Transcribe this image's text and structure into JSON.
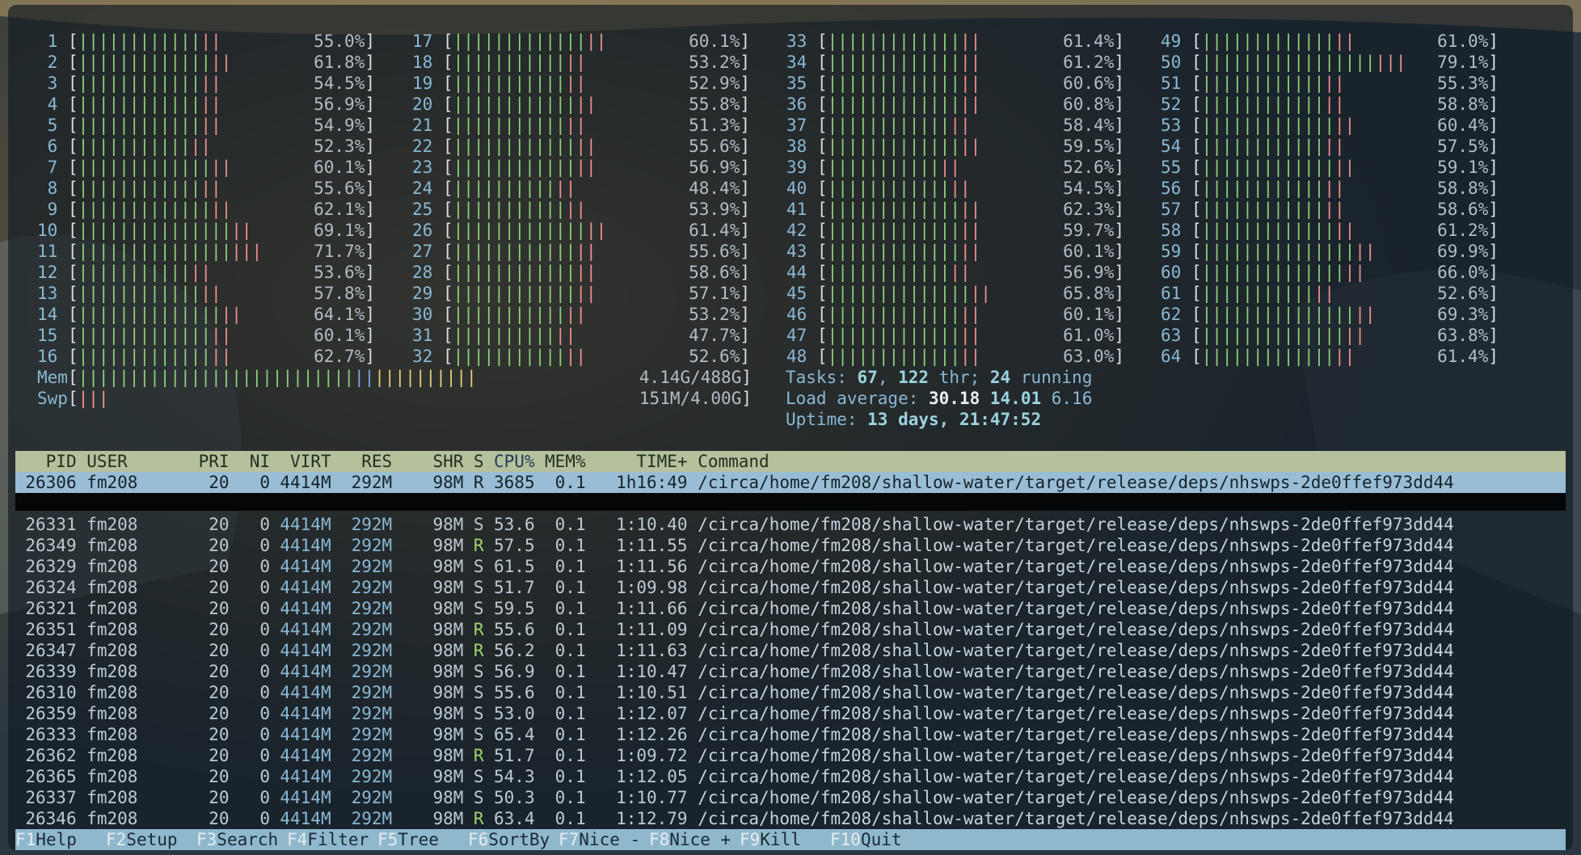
{
  "cpus": [
    {
      "id": "1",
      "pct": "55.0%",
      "g": 12,
      "r": 2,
      "y": 0,
      "b": 0
    },
    {
      "id": "2",
      "pct": "61.8%",
      "g": 13,
      "r": 2,
      "y": 0,
      "b": 0
    },
    {
      "id": "3",
      "pct": "54.5%",
      "g": 12,
      "r": 2,
      "y": 0,
      "b": 0
    },
    {
      "id": "4",
      "pct": "56.9%",
      "g": 12,
      "r": 2,
      "y": 0,
      "b": 0
    },
    {
      "id": "5",
      "pct": "54.9%",
      "g": 12,
      "r": 2,
      "y": 0,
      "b": 0
    },
    {
      "id": "6",
      "pct": "52.3%",
      "g": 11,
      "r": 2,
      "y": 0,
      "b": 0
    },
    {
      "id": "7",
      "pct": "60.1%",
      "g": 13,
      "r": 2,
      "y": 0,
      "b": 0
    },
    {
      "id": "8",
      "pct": "55.6%",
      "g": 12,
      "r": 2,
      "y": 0,
      "b": 0
    },
    {
      "id": "9",
      "pct": "62.1%",
      "g": 13,
      "r": 2,
      "y": 0,
      "b": 0
    },
    {
      "id": "10",
      "pct": "69.1%",
      "g": 15,
      "r": 2,
      "y": 0,
      "b": 0
    },
    {
      "id": "11",
      "pct": "71.7%",
      "g": 15,
      "r": 3,
      "y": 0,
      "b": 0
    },
    {
      "id": "12",
      "pct": "53.6%",
      "g": 11,
      "r": 2,
      "y": 0,
      "b": 0
    },
    {
      "id": "13",
      "pct": "57.8%",
      "g": 12,
      "r": 2,
      "y": 0,
      "b": 0
    },
    {
      "id": "14",
      "pct": "64.1%",
      "g": 14,
      "r": 2,
      "y": 0,
      "b": 0
    },
    {
      "id": "15",
      "pct": "60.1%",
      "g": 13,
      "r": 2,
      "y": 0,
      "b": 0
    },
    {
      "id": "16",
      "pct": "62.7%",
      "g": 13,
      "r": 2,
      "y": 0,
      "b": 0
    },
    {
      "id": "17",
      "pct": "60.1%",
      "g": 13,
      "r": 2,
      "y": 0,
      "b": 0
    },
    {
      "id": "18",
      "pct": "53.2%",
      "g": 11,
      "r": 2,
      "y": 0,
      "b": 0
    },
    {
      "id": "19",
      "pct": "52.9%",
      "g": 11,
      "r": 2,
      "y": 0,
      "b": 0
    },
    {
      "id": "20",
      "pct": "55.8%",
      "g": 12,
      "r": 2,
      "y": 0,
      "b": 0
    },
    {
      "id": "21",
      "pct": "51.3%",
      "g": 11,
      "r": 2,
      "y": 0,
      "b": 0
    },
    {
      "id": "22",
      "pct": "55.6%",
      "g": 12,
      "r": 2,
      "y": 0,
      "b": 0
    },
    {
      "id": "23",
      "pct": "56.9%",
      "g": 12,
      "r": 2,
      "y": 0,
      "b": 0
    },
    {
      "id": "24",
      "pct": "48.4%",
      "g": 10,
      "r": 2,
      "y": 0,
      "b": 0
    },
    {
      "id": "25",
      "pct": "53.9%",
      "g": 11,
      "r": 2,
      "y": 0,
      "b": 0
    },
    {
      "id": "26",
      "pct": "61.4%",
      "g": 13,
      "r": 2,
      "y": 0,
      "b": 0
    },
    {
      "id": "27",
      "pct": "55.6%",
      "g": 12,
      "r": 2,
      "y": 0,
      "b": 0
    },
    {
      "id": "28",
      "pct": "58.6%",
      "g": 12,
      "r": 2,
      "y": 0,
      "b": 0
    },
    {
      "id": "29",
      "pct": "57.1%",
      "g": 12,
      "r": 2,
      "y": 0,
      "b": 0
    },
    {
      "id": "30",
      "pct": "53.2%",
      "g": 11,
      "r": 2,
      "y": 0,
      "b": 0
    },
    {
      "id": "31",
      "pct": "47.7%",
      "g": 10,
      "r": 2,
      "y": 0,
      "b": 0
    },
    {
      "id": "32",
      "pct": "52.6%",
      "g": 11,
      "r": 2,
      "y": 0,
      "b": 0
    },
    {
      "id": "33",
      "pct": "61.4%",
      "g": 13,
      "r": 2,
      "y": 0,
      "b": 0
    },
    {
      "id": "34",
      "pct": "61.2%",
      "g": 13,
      "r": 2,
      "y": 0,
      "b": 0
    },
    {
      "id": "35",
      "pct": "60.6%",
      "g": 13,
      "r": 2,
      "y": 0,
      "b": 0
    },
    {
      "id": "36",
      "pct": "60.8%",
      "g": 13,
      "r": 2,
      "y": 0,
      "b": 0
    },
    {
      "id": "37",
      "pct": "58.4%",
      "g": 12,
      "r": 2,
      "y": 0,
      "b": 0
    },
    {
      "id": "38",
      "pct": "59.5%",
      "g": 13,
      "r": 2,
      "y": 0,
      "b": 0
    },
    {
      "id": "39",
      "pct": "52.6%",
      "g": 11,
      "r": 2,
      "y": 0,
      "b": 0
    },
    {
      "id": "40",
      "pct": "54.5%",
      "g": 12,
      "r": 2,
      "y": 0,
      "b": 0
    },
    {
      "id": "41",
      "pct": "62.3%",
      "g": 13,
      "r": 2,
      "y": 0,
      "b": 0
    },
    {
      "id": "42",
      "pct": "59.7%",
      "g": 13,
      "r": 2,
      "y": 0,
      "b": 0
    },
    {
      "id": "43",
      "pct": "60.1%",
      "g": 13,
      "r": 2,
      "y": 0,
      "b": 0
    },
    {
      "id": "44",
      "pct": "56.9%",
      "g": 12,
      "r": 2,
      "y": 0,
      "b": 0
    },
    {
      "id": "45",
      "pct": "65.8%",
      "g": 14,
      "r": 2,
      "y": 0,
      "b": 0
    },
    {
      "id": "46",
      "pct": "60.1%",
      "g": 13,
      "r": 2,
      "y": 0,
      "b": 0
    },
    {
      "id": "47",
      "pct": "61.0%",
      "g": 13,
      "r": 2,
      "y": 0,
      "b": 0
    },
    {
      "id": "48",
      "pct": "63.0%",
      "g": 13,
      "r": 2,
      "y": 0,
      "b": 0
    },
    {
      "id": "49",
      "pct": "61.0%",
      "g": 13,
      "r": 2,
      "y": 0,
      "b": 0
    },
    {
      "id": "50",
      "pct": "79.1%",
      "g": 17,
      "r": 3,
      "y": 0,
      "b": 0
    },
    {
      "id": "51",
      "pct": "55.3%",
      "g": 12,
      "r": 2,
      "y": 0,
      "b": 0
    },
    {
      "id": "52",
      "pct": "58.8%",
      "g": 12,
      "r": 2,
      "y": 0,
      "b": 0
    },
    {
      "id": "53",
      "pct": "60.4%",
      "g": 13,
      "r": 2,
      "y": 0,
      "b": 0
    },
    {
      "id": "54",
      "pct": "57.5%",
      "g": 12,
      "r": 2,
      "y": 0,
      "b": 0
    },
    {
      "id": "55",
      "pct": "59.1%",
      "g": 13,
      "r": 2,
      "y": 0,
      "b": 0
    },
    {
      "id": "56",
      "pct": "58.8%",
      "g": 12,
      "r": 2,
      "y": 0,
      "b": 0
    },
    {
      "id": "57",
      "pct": "58.6%",
      "g": 12,
      "r": 2,
      "y": 0,
      "b": 0
    },
    {
      "id": "58",
      "pct": "61.2%",
      "g": 13,
      "r": 2,
      "y": 0,
      "b": 0
    },
    {
      "id": "59",
      "pct": "69.9%",
      "g": 15,
      "r": 2,
      "y": 0,
      "b": 0
    },
    {
      "id": "60",
      "pct": "66.0%",
      "g": 14,
      "r": 2,
      "y": 0,
      "b": 0
    },
    {
      "id": "61",
      "pct": "52.6%",
      "g": 11,
      "r": 2,
      "y": 0,
      "b": 0
    },
    {
      "id": "62",
      "pct": "69.3%",
      "g": 15,
      "r": 2,
      "y": 0,
      "b": 0
    },
    {
      "id": "63",
      "pct": "63.8%",
      "g": 14,
      "r": 2,
      "y": 0,
      "b": 0
    },
    {
      "id": "64",
      "pct": "61.4%",
      "g": 13,
      "r": 2,
      "y": 0,
      "b": 0
    }
  ],
  "memory": {
    "mem_label": "Mem",
    "mem_value": "4.14G/488G",
    "swp_label": "Swp",
    "swp_value": "151M/4.00G",
    "mem_bar": {
      "g": 27,
      "b": 2,
      "y": 10
    },
    "swp_bar": {
      "r": 3
    }
  },
  "stats": {
    "tasks_label": "Tasks: ",
    "tasks": "67",
    "sep1": ", ",
    "threads": "122",
    "thr_label": " thr; ",
    "running": "24",
    "running_label": " running",
    "load_label": "Load average: ",
    "load1": "30.18",
    "load5": "14.01",
    "load15": "6.16",
    "uptime_label": "Uptime: ",
    "uptime": "13 days, 21:47:52"
  },
  "table_header": {
    "pid": "PID",
    "user": "USER",
    "pri": "PRI",
    "ni": "NI",
    "virt": "VIRT",
    "res": "RES",
    "shr": "SHR",
    "s": "S",
    "cpu": "CPU%",
    "mem": "MEM%",
    "time": "TIME+",
    "command": "Command"
  },
  "selected_process": {
    "pid": "26306",
    "user": "fm208",
    "pri": "20",
    "ni": "0",
    "virt": "4414M",
    "res": "292M",
    "shr": "98M",
    "s": "R",
    "cpu": "3685",
    "mem": "0.1",
    "time": "1h16:49",
    "command": "/circa/home/fm208/shallow-water/target/release/deps/nhswps-2de0ffef973dd44"
  },
  "processes": [
    {
      "pid": "26331",
      "user": "fm208",
      "pri": "20",
      "ni": "0",
      "virt": "4414M",
      "res": "292M",
      "shr": "98M",
      "s": "S",
      "cpu": "53.6",
      "mem": "0.1",
      "time": "1:10.40",
      "command": "/circa/home/fm208/shallow-water/target/release/deps/nhswps-2de0ffef973dd44"
    },
    {
      "pid": "26349",
      "user": "fm208",
      "pri": "20",
      "ni": "0",
      "virt": "4414M",
      "res": "292M",
      "shr": "98M",
      "s": "R",
      "cpu": "57.5",
      "mem": "0.1",
      "time": "1:11.55",
      "command": "/circa/home/fm208/shallow-water/target/release/deps/nhswps-2de0ffef973dd44"
    },
    {
      "pid": "26329",
      "user": "fm208",
      "pri": "20",
      "ni": "0",
      "virt": "4414M",
      "res": "292M",
      "shr": "98M",
      "s": "S",
      "cpu": "61.5",
      "mem": "0.1",
      "time": "1:11.56",
      "command": "/circa/home/fm208/shallow-water/target/release/deps/nhswps-2de0ffef973dd44"
    },
    {
      "pid": "26324",
      "user": "fm208",
      "pri": "20",
      "ni": "0",
      "virt": "4414M",
      "res": "292M",
      "shr": "98M",
      "s": "S",
      "cpu": "51.7",
      "mem": "0.1",
      "time": "1:09.98",
      "command": "/circa/home/fm208/shallow-water/target/release/deps/nhswps-2de0ffef973dd44"
    },
    {
      "pid": "26321",
      "user": "fm208",
      "pri": "20",
      "ni": "0",
      "virt": "4414M",
      "res": "292M",
      "shr": "98M",
      "s": "S",
      "cpu": "59.5",
      "mem": "0.1",
      "time": "1:11.66",
      "command": "/circa/home/fm208/shallow-water/target/release/deps/nhswps-2de0ffef973dd44"
    },
    {
      "pid": "26351",
      "user": "fm208",
      "pri": "20",
      "ni": "0",
      "virt": "4414M",
      "res": "292M",
      "shr": "98M",
      "s": "R",
      "cpu": "55.6",
      "mem": "0.1",
      "time": "1:11.09",
      "command": "/circa/home/fm208/shallow-water/target/release/deps/nhswps-2de0ffef973dd44"
    },
    {
      "pid": "26347",
      "user": "fm208",
      "pri": "20",
      "ni": "0",
      "virt": "4414M",
      "res": "292M",
      "shr": "98M",
      "s": "R",
      "cpu": "56.2",
      "mem": "0.1",
      "time": "1:11.63",
      "command": "/circa/home/fm208/shallow-water/target/release/deps/nhswps-2de0ffef973dd44"
    },
    {
      "pid": "26339",
      "user": "fm208",
      "pri": "20",
      "ni": "0",
      "virt": "4414M",
      "res": "292M",
      "shr": "98M",
      "s": "S",
      "cpu": "56.9",
      "mem": "0.1",
      "time": "1:10.47",
      "command": "/circa/home/fm208/shallow-water/target/release/deps/nhswps-2de0ffef973dd44"
    },
    {
      "pid": "26310",
      "user": "fm208",
      "pri": "20",
      "ni": "0",
      "virt": "4414M",
      "res": "292M",
      "shr": "98M",
      "s": "S",
      "cpu": "55.6",
      "mem": "0.1",
      "time": "1:10.51",
      "command": "/circa/home/fm208/shallow-water/target/release/deps/nhswps-2de0ffef973dd44"
    },
    {
      "pid": "26359",
      "user": "fm208",
      "pri": "20",
      "ni": "0",
      "virt": "4414M",
      "res": "292M",
      "shr": "98M",
      "s": "S",
      "cpu": "53.0",
      "mem": "0.1",
      "time": "1:12.07",
      "command": "/circa/home/fm208/shallow-water/target/release/deps/nhswps-2de0ffef973dd44"
    },
    {
      "pid": "26333",
      "user": "fm208",
      "pri": "20",
      "ni": "0",
      "virt": "4414M",
      "res": "292M",
      "shr": "98M",
      "s": "S",
      "cpu": "65.4",
      "mem": "0.1",
      "time": "1:12.26",
      "command": "/circa/home/fm208/shallow-water/target/release/deps/nhswps-2de0ffef973dd44"
    },
    {
      "pid": "26362",
      "user": "fm208",
      "pri": "20",
      "ni": "0",
      "virt": "4414M",
      "res": "292M",
      "shr": "98M",
      "s": "R",
      "cpu": "51.7",
      "mem": "0.1",
      "time": "1:09.72",
      "command": "/circa/home/fm208/shallow-water/target/release/deps/nhswps-2de0ffef973dd44"
    },
    {
      "pid": "26365",
      "user": "fm208",
      "pri": "20",
      "ni": "0",
      "virt": "4414M",
      "res": "292M",
      "shr": "98M",
      "s": "S",
      "cpu": "54.3",
      "mem": "0.1",
      "time": "1:12.05",
      "command": "/circa/home/fm208/shallow-water/target/release/deps/nhswps-2de0ffef973dd44"
    },
    {
      "pid": "26337",
      "user": "fm208",
      "pri": "20",
      "ni": "0",
      "virt": "4414M",
      "res": "292M",
      "shr": "98M",
      "s": "S",
      "cpu": "50.3",
      "mem": "0.1",
      "time": "1:10.77",
      "command": "/circa/home/fm208/shallow-water/target/release/deps/nhswps-2de0ffef973dd44"
    },
    {
      "pid": "26346",
      "user": "fm208",
      "pri": "20",
      "ni": "0",
      "virt": "4414M",
      "res": "292M",
      "shr": "98M",
      "s": "R",
      "cpu": "63.4",
      "mem": "0.1",
      "time": "1:12.79",
      "command": "/circa/home/fm208/shallow-water/target/release/deps/nhswps-2de0ffef973dd44"
    }
  ],
  "function_keys": [
    {
      "key": "F1",
      "label": "Help"
    },
    {
      "key": "F2",
      "label": "Setup"
    },
    {
      "key": "F3",
      "label": "Search"
    },
    {
      "key": "F4",
      "label": "Filter"
    },
    {
      "key": "F5",
      "label": "Tree"
    },
    {
      "key": "F6",
      "label": "SortBy"
    },
    {
      "key": "F7",
      "label": "Nice -"
    },
    {
      "key": "F8",
      "label": "Nice +"
    },
    {
      "key": "F9",
      "label": "Kill"
    },
    {
      "key": "F10",
      "label": "Quit"
    }
  ],
  "colors": {
    "bar_normal": "#8fcf7a",
    "bar_kernel": "#ef8f8f",
    "bar_cache": "#e4cf7a",
    "bar_buffer": "#7fa9e6",
    "header_bg": "#b5c09c",
    "selection_bg": "#98bdd4",
    "fkey_bg": "#8fb8cc"
  }
}
